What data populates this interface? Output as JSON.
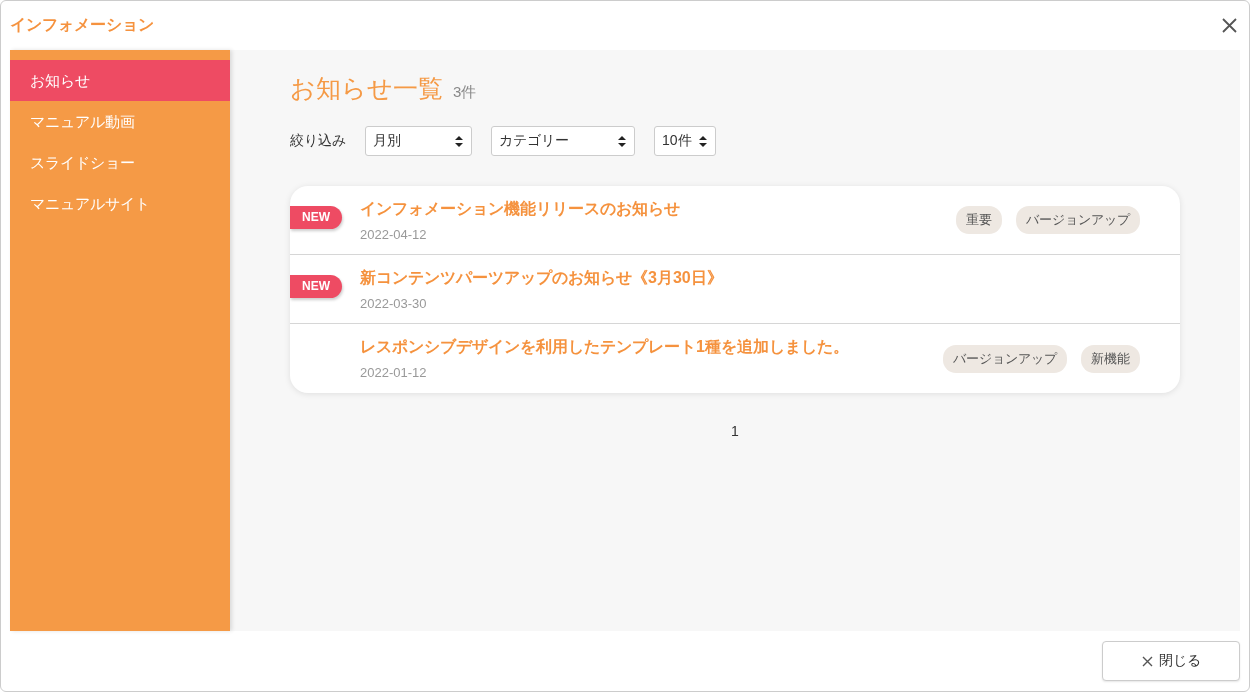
{
  "window": {
    "title": "インフォメーション"
  },
  "sidebar": {
    "items": [
      {
        "label": "お知らせ",
        "selected": true
      },
      {
        "label": "マニュアル動画",
        "selected": false
      },
      {
        "label": "スライドショー",
        "selected": false
      },
      {
        "label": "マニュアルサイト",
        "selected": false
      }
    ]
  },
  "heading": {
    "title": "お知らせ一覧",
    "count": "3件"
  },
  "filters": {
    "label": "絞り込み",
    "selects": [
      {
        "value": "月別",
        "kind": "month"
      },
      {
        "value": "カテゴリー",
        "kind": "category"
      },
      {
        "value": "10件",
        "kind": "per-page"
      }
    ]
  },
  "notices": [
    {
      "title": "インフォメーション機能リリースのお知らせ",
      "date": "2022-04-12",
      "is_new": true,
      "badge": "NEW",
      "tags": [
        "重要",
        "バージョンアップ"
      ]
    },
    {
      "title": "新コンテンツパーツアップのお知らせ《3月30日》",
      "date": "2022-03-30",
      "is_new": true,
      "badge": "NEW"
    },
    {
      "title": "レスポンシブデザインを利用したテンプレート1種を追加しました。",
      "date": "2022-01-12",
      "is_new": false,
      "tags": [
        "バージョンアップ",
        "新機能"
      ]
    }
  ],
  "pagination": {
    "pages": [
      {
        "label": "1",
        "selected": true
      }
    ]
  },
  "footer": {
    "close_button": "閉じる"
  }
}
